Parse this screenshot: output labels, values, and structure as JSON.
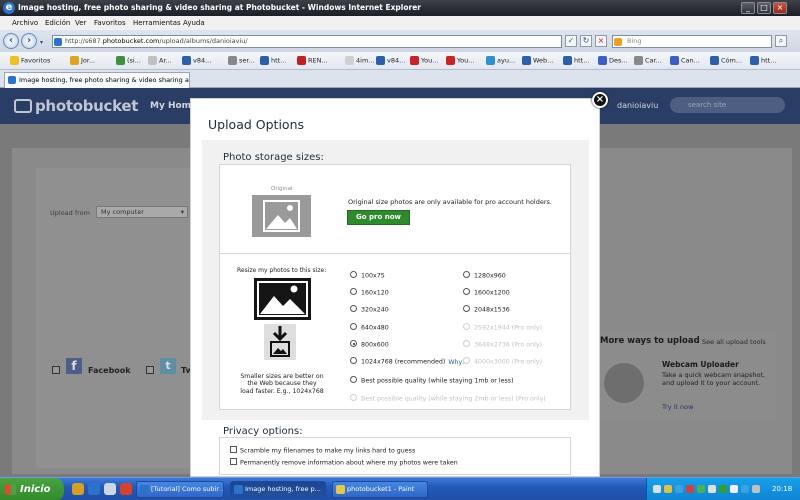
{
  "window": {
    "title": "Image hosting, free photo sharing & video sharing at Photobucket - Windows Internet Explorer"
  },
  "menu": [
    "Archivo",
    "Edición",
    "Ver",
    "Favoritos",
    "Herramientas",
    "Ayuda"
  ],
  "address": {
    "url_prefix": "http://s687.",
    "url_domain": "photobucket.com",
    "url_path": "/upload/albums/danioiaviu/"
  },
  "search_placeholder": "Bing",
  "favorites": {
    "label": "Favoritos",
    "items": [
      "Jor...",
      "(si...",
      "Ar...",
      "v84...",
      "ser...",
      "htt...",
      "REN...",
      "4im...",
      "v84...",
      "You...",
      "You...",
      "ayu...",
      "Web...",
      "htt...",
      "Des...",
      "Car...",
      "Can...",
      "Cóm...",
      "htt..."
    ],
    "colors": [
      "#e0a520",
      "#3e8f3e",
      "#c0c0c0",
      "#2b5fa8",
      "#888888",
      "#2b5fa8",
      "#c02020",
      "#d0d0d0",
      "#2b5fa8",
      "#cc2222",
      "#cc2222",
      "#2b8fd0",
      "#2b5fa8",
      "#2b5fa8",
      "#3a5fc8",
      "#888888",
      "#3a5fc8",
      "#2b5fa8",
      "#2b5fa8"
    ]
  },
  "tab": {
    "title": "Image hosting, free photo sharing & video sharing at ..."
  },
  "photobucket": {
    "logo": "photobucket",
    "nav_home": "My Home",
    "username": "danioiaviu",
    "search_placeholder": "search site",
    "upload_from_label": "Upload from",
    "upload_from_value": "My computer",
    "facebook": "Facebook",
    "twitter": "Tw",
    "more_ways": {
      "title": "More ways to upload",
      "link": "See all upload tools",
      "webcam_title": "Webcam Uploader",
      "webcam_desc": "Take a quick webcam snapshot, and upload it to your account.",
      "try_now": "Try it now"
    }
  },
  "modal": {
    "title": "Upload Options",
    "storage_heading": "Photo storage sizes:",
    "original_label": "Original",
    "original_text": "Original size photos are only available for pro account holders.",
    "go_pro": "Go pro now",
    "resize_label": "Resize my photos to this size:",
    "note": "Smaller sizes are better on the Web because they load faster. E.g., 1024x768",
    "sizes_left": [
      {
        "label": "100x75",
        "selected": false,
        "disabled": false
      },
      {
        "label": "160x120",
        "selected": false,
        "disabled": false
      },
      {
        "label": "320x240",
        "selected": false,
        "disabled": false
      },
      {
        "label": "640x480",
        "selected": false,
        "disabled": false
      },
      {
        "label": "800x600",
        "selected": true,
        "disabled": false
      },
      {
        "label": "1024x768 (recommended)",
        "selected": false,
        "disabled": false
      }
    ],
    "why_link": "Why?",
    "sizes_right": [
      {
        "label": "1280x960",
        "selected": false,
        "disabled": false
      },
      {
        "label": "1600x1200",
        "selected": false,
        "disabled": false
      },
      {
        "label": "2048x1536",
        "selected": false,
        "disabled": false
      },
      {
        "label": "2592x1944 (Pro only)",
        "selected": false,
        "disabled": true
      },
      {
        "label": "3648x2736 (Pro only)",
        "selected": false,
        "disabled": true
      },
      {
        "label": "4000x3000 (Pro only)",
        "selected": false,
        "disabled": true
      }
    ],
    "best_quality": "Best possible quality (while staying 1mb or less)",
    "best_quality_pro": "Best possible quality (while staying 2mb or less) (Pro only)",
    "privacy_heading": "Privacy options:",
    "privacy_options": [
      "Scramble my filenames to make my links hard to guess",
      "Permanently remove information about where my photos were taken"
    ]
  },
  "taskbar": {
    "start": "Inicio",
    "tasks": [
      "[Tutorial] Como subir ...",
      "Image hosting, free p...",
      "photobucket1 - Paint"
    ],
    "clock": "20:18"
  }
}
